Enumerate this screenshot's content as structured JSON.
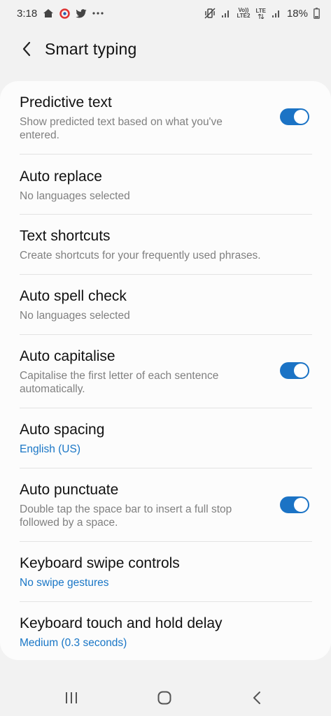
{
  "status_bar": {
    "time": "3:18",
    "volte_top": "Vo))",
    "volte_bottom": "LTE2",
    "lte_label": "LTE",
    "battery": "18%"
  },
  "header": {
    "title": "Smart typing"
  },
  "settings": [
    {
      "title": "Predictive text",
      "subtitle": "Show predicted text based on what you've entered.",
      "toggle": true
    },
    {
      "title": "Auto replace",
      "subtitle": "No languages selected"
    },
    {
      "title": "Text shortcuts",
      "subtitle": "Create shortcuts for your frequently used phrases."
    },
    {
      "title": "Auto spell check",
      "subtitle": "No languages selected"
    },
    {
      "title": "Auto capitalise",
      "subtitle": "Capitalise the first letter of each sentence automatically.",
      "toggle": true
    },
    {
      "title": "Auto spacing",
      "subtitle": "English (US)"
    },
    {
      "title": "Auto punctuate",
      "subtitle": "Double tap the space bar to insert a full stop followed by a space.",
      "toggle": true
    },
    {
      "title": "Keyboard swipe controls",
      "subtitle": "No swipe gestures"
    },
    {
      "title": "Keyboard touch and hold delay",
      "subtitle": "Medium (0.3 seconds)"
    }
  ],
  "colors": {
    "accent": "#1b73c5",
    "background": "#f2f2f2",
    "card": "#fcfcfc"
  },
  "nav_icons": [
    "recent-apps-icon",
    "home-icon",
    "back-icon"
  ]
}
